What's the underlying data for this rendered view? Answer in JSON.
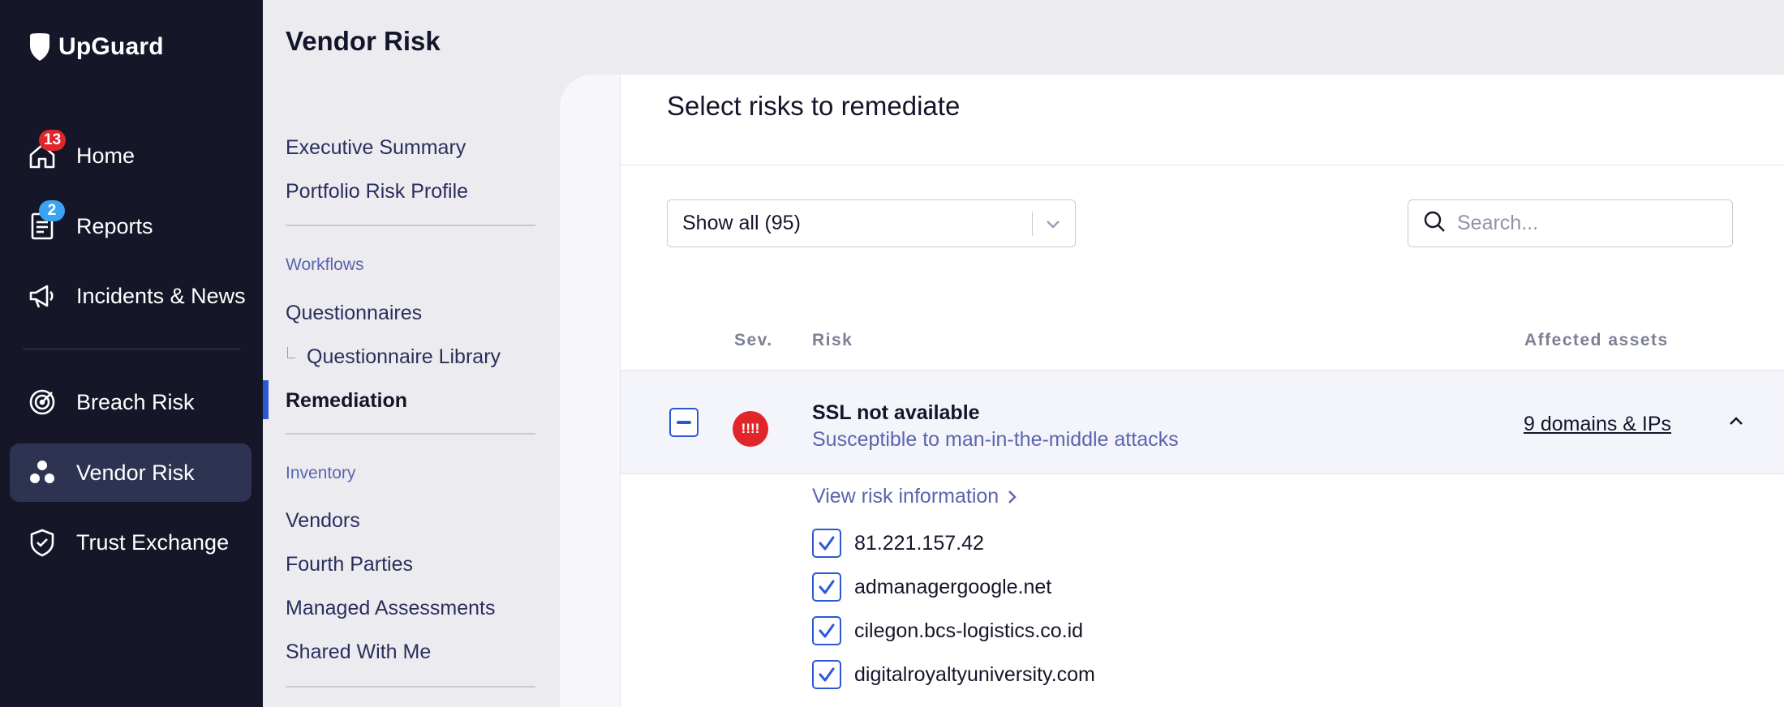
{
  "app": {
    "name": "UpGuard"
  },
  "nav": {
    "items": [
      {
        "label": "Home",
        "badge": "13",
        "icon": "home-icon"
      },
      {
        "label": "Reports",
        "badge": "2",
        "icon": "report-icon"
      },
      {
        "label": "Incidents & News",
        "icon": "megaphone-icon"
      },
      {
        "label": "Breach Risk",
        "icon": "target-icon"
      },
      {
        "label": "Vendor Risk",
        "icon": "vendor-icon",
        "active": true
      },
      {
        "label": "Trust Exchange",
        "icon": "shield-check-icon"
      }
    ]
  },
  "subnav": {
    "title": "Vendor Risk",
    "links_top": [
      "Executive Summary",
      "Portfolio Risk Profile"
    ],
    "workflows_label": "Workflows",
    "workflows": [
      "Questionnaires",
      "Questionnaire Library",
      "Remediation"
    ],
    "inventory_label": "Inventory",
    "inventory": [
      "Vendors",
      "Fourth Parties",
      "Managed Assessments",
      "Shared With Me"
    ]
  },
  "main": {
    "title": "Select risks to remediate",
    "filter": {
      "value": "Show all (95)"
    },
    "search": {
      "placeholder": "Search..."
    },
    "columns": {
      "sev": "Sev.",
      "risk": "Risk",
      "assets": "Affected assets"
    },
    "risk": {
      "severity_label": "!!!!",
      "title": "SSL not available",
      "subtitle": "Susceptible to man-in-the-middle attacks",
      "assets_link": "9 domains & IPs",
      "view_info": "View risk information",
      "assets": [
        "81.221.157.42",
        "admanagergoogle.net",
        "cilegon.bcs-logistics.co.id",
        "digitalroyaltyuniversity.com"
      ]
    }
  },
  "colors": {
    "nav_bg": "#151729",
    "accent": "#2c58d6",
    "severity": "#e1262b",
    "link": "#5a64b0"
  }
}
